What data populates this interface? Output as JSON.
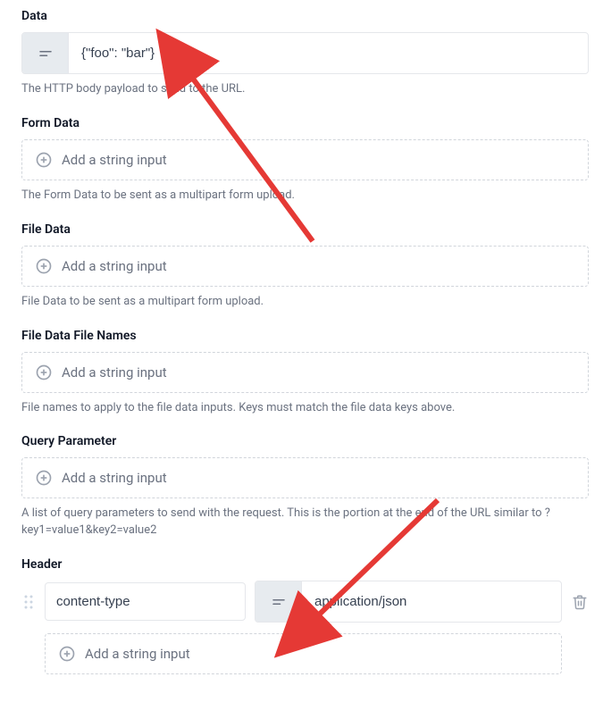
{
  "labels": {
    "data": "Data",
    "formData": "Form Data",
    "fileData": "File Data",
    "fileDataFileNames": "File Data File Names",
    "queryParameter": "Query Parameter",
    "header": "Header"
  },
  "help": {
    "data": "The HTTP body payload to send to the URL.",
    "formData": "The Form Data to be sent as a multipart form upload.",
    "fileData": "File Data to be sent as a multipart form upload.",
    "fileDataFileNames": "File names to apply to the file data inputs. Keys must match the file data keys above.",
    "queryParameter": "A list of query parameters to send with the request. This is the portion at the end of the URL similar to ?key1=value1&key2=value2"
  },
  "values": {
    "data": "{\"foo\": \"bar\"}",
    "headerKey": "content-type",
    "headerValue": "application/json"
  },
  "common": {
    "addStringInput": "Add a string input"
  }
}
